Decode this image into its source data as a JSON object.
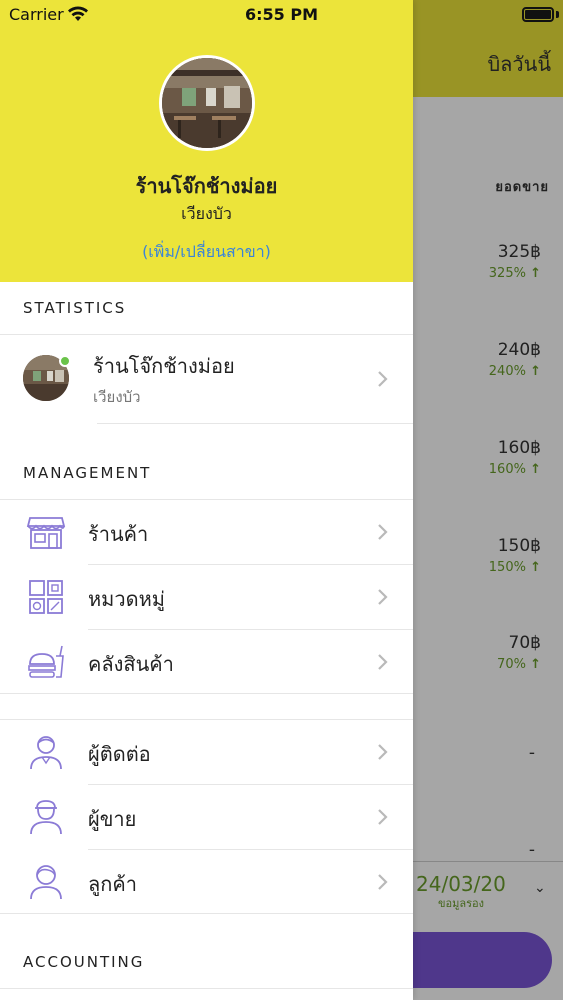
{
  "status_bar": {
    "carrier": "Carrier",
    "time": "6:55 PM"
  },
  "background": {
    "title": "บิลวันนี้",
    "column_header": "ยอดขาย",
    "rows": [
      {
        "amount": "325฿",
        "percent": "325%"
      },
      {
        "amount": "240฿",
        "percent": "240%"
      },
      {
        "amount": "160฿",
        "percent": "160%"
      },
      {
        "amount": "150฿",
        "percent": "150%"
      },
      {
        "amount": "70฿",
        "percent": "70%"
      }
    ],
    "empty_rows": [
      "-",
      "-"
    ],
    "date": "24/03/20",
    "date_caption": "ขอมูลรอง"
  },
  "drawer": {
    "shop_name": "ร้านโจ๊กช้างม่อย",
    "branch_name": "เวียงบัว",
    "change_branch_link": "(เพิ่ม/เปลี่ยนสาขา)",
    "sections": {
      "statistics": "STATISTICS",
      "management": "MANAGEMENT",
      "accounting": "ACCOUNTING"
    },
    "statistics_item": {
      "title": "ร้านโจ๊กช้างม่อย",
      "subtitle": "เวียงบัว"
    },
    "management_items": [
      {
        "label": "ร้านค้า",
        "icon": "store-icon"
      },
      {
        "label": "หมวดหมู่",
        "icon": "category-grid-icon"
      },
      {
        "label": "คลังสินค้า",
        "icon": "food-inventory-icon"
      }
    ],
    "people_items": [
      {
        "label": "ผู้ติดต่อ",
        "icon": "contact-person-icon"
      },
      {
        "label": "ผู้ขาย",
        "icon": "seller-person-icon"
      },
      {
        "label": "ลูกค้า",
        "icon": "customer-person-icon"
      }
    ]
  },
  "colors": {
    "header_yellow": "#ece43a",
    "link_blue": "#3b84d8",
    "icon_purple": "#8b7bd6",
    "positive_green": "#6a9d2c",
    "online_green": "#6ac34a",
    "action_purple": "#7a55d6"
  }
}
